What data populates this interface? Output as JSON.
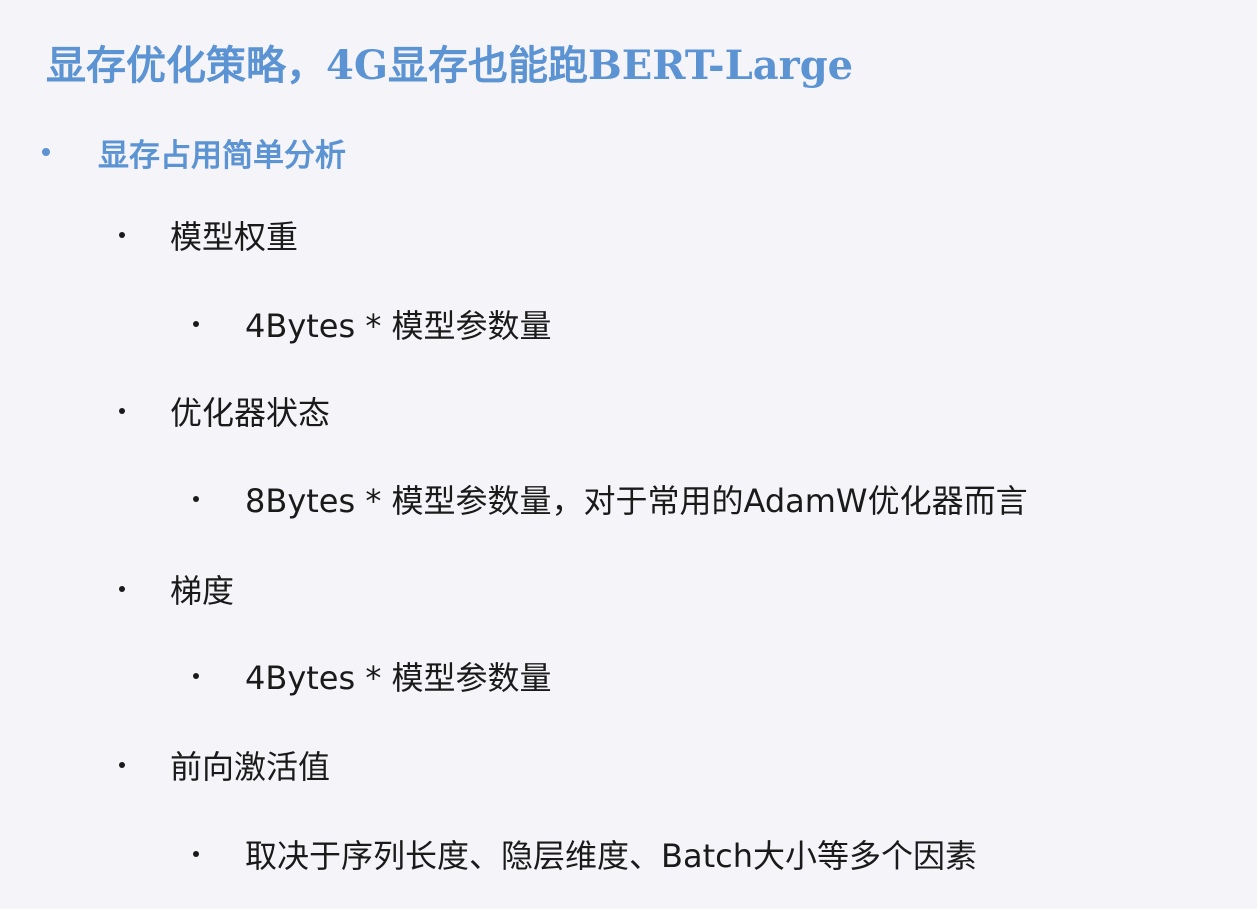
{
  "slide": {
    "title": "显存优化策略，4G显存也能跑BERT-Large",
    "items": [
      {
        "level": 1,
        "text": "显存占用简单分析"
      },
      {
        "level": 2,
        "text": "模型权重"
      },
      {
        "level": 3,
        "text": "4Bytes * 模型参数量"
      },
      {
        "level": 2,
        "text": "优化器状态"
      },
      {
        "level": 3,
        "text": "8Bytes * 模型参数量，对于常用的AdamW优化器而言"
      },
      {
        "level": 2,
        "text": "梯度"
      },
      {
        "level": 3,
        "text": "4Bytes * 模型参数量"
      },
      {
        "level": 2,
        "text": "前向激活值"
      },
      {
        "level": 3,
        "text": "取决于序列长度、隐层维度、Batch大小等多个因素"
      }
    ]
  },
  "colors": {
    "accent": "#5b93d3",
    "text": "#1a1a1a",
    "background": "#f5f5f9"
  }
}
